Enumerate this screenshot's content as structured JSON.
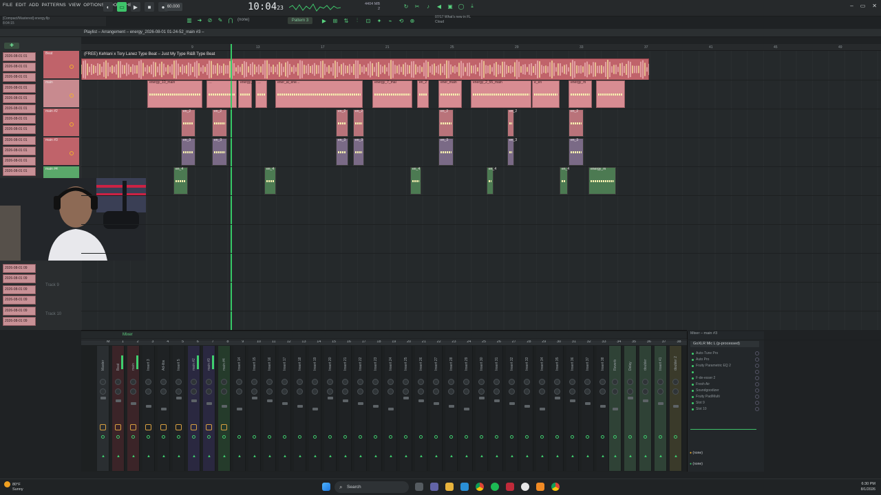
{
  "menu": [
    "FILE",
    "EDIT",
    "ADD",
    "PATTERNS",
    "VIEW",
    "OPTIONS",
    "TOOLS",
    "HELP"
  ],
  "project": {
    "file": "energy.flp",
    "pos": "8:04:15",
    "line0": "[Compact/Mastered] energy.flp"
  },
  "transport": {
    "tempo": "60.000",
    "time": "10:04",
    "time_sub": "23",
    "beat_label": "Beat"
  },
  "cpu": {
    "mem": "4404 MB",
    "voices": "2"
  },
  "pattern_label": "Pattern 3",
  "none_label": "(none)",
  "hint": {
    "line1": "07/17  What's new in FL",
    "line2": "Cloud"
  },
  "playlist": {
    "title": "Playlist – Arrangement – energy_2026-08-01 01-24-52_main #3 –",
    "top_clip_label": "(FREE) Kehlani x Tory Lanez Type Beat – Just My Type R&B Type Beat",
    "ruler": [
      "9",
      "13",
      "17",
      "21",
      "25",
      "29",
      "33",
      "37",
      "41",
      "45",
      "49",
      "53",
      "57",
      "61",
      "65"
    ],
    "track_names": [
      "2026-08-01 01",
      "2026-08-01 01",
      "2026-08-01 01",
      "2026-08-01 01",
      "2026-08-01 01",
      "2026-08-01 01",
      "2026-08-01 01",
      "2026-08-01 01",
      "2026-08-01 01",
      "2026-08-01 01",
      "2026-08-01 01",
      "2026-08-01 01"
    ],
    "lower_track_names": [
      "2026-08-01 09",
      "2026-08-01 09",
      "2026-08-01 09",
      "2026-08-01 09",
      "2026-08-01 09",
      "2026-08-01 09"
    ],
    "headers": [
      "Beat",
      "main",
      "main #2",
      "main #3",
      "main #4"
    ],
    "track9": "Track 9",
    "track10": "Track 10",
    "main_clips": [
      "energy_10_main",
      "…",
      "energy_9",
      "…",
      "ener_ai_ene…",
      "energy_7_mai",
      "en_2",
      "ener_main",
      "energy_2_55_main",
      "e_en",
      "energy_m"
    ],
    "sub_clips": [
      "en_2",
      "en_2",
      "en_3",
      "en_3",
      "en_4",
      "energy_m"
    ]
  },
  "mixer": {
    "title": "Mixer",
    "numbers": [
      "M",
      "1",
      "2",
      "3",
      "4",
      "5",
      "6",
      "7",
      "8",
      "9",
      "10",
      "11",
      "12",
      "13",
      "14",
      "15",
      "16",
      "17",
      "18",
      "19",
      "20",
      "21",
      "22",
      "23",
      "24",
      "25",
      "26",
      "27",
      "28",
      "29",
      "30",
      "31",
      "32",
      "33",
      "34",
      "35",
      "36",
      "37",
      "38",
      "39",
      "40",
      "41",
      "42",
      "43"
    ],
    "strips": [
      "Master",
      "Beat",
      "main",
      "Insert 3",
      "Ad-libs",
      "Insert 5",
      "main #2",
      "main #3",
      "main #4",
      "Insert 14",
      "Insert 15",
      "Insert 16",
      "Insert 17",
      "Insert 18",
      "Insert 19",
      "Insert 20",
      "Insert 21",
      "Insert 22",
      "Insert 23",
      "Insert 24",
      "Insert 25",
      "Insert 26",
      "Insert 27",
      "Insert 28",
      "Insert 29",
      "Insert 30",
      "Insert 31",
      "Insert 32",
      "Insert 33",
      "Insert 34",
      "Insert 35",
      "Insert 36",
      "Insert 37",
      "Insert 38",
      "Reverb",
      "Delay",
      "doubler",
      "Insert 41",
      "doubler 2",
      "Insert 43"
    ]
  },
  "inserts": {
    "title": "Mixer – main #3",
    "source": "GoXLR Mic L (p-processed)",
    "slots": [
      "Auto-Tune Pro",
      "Auto Pro",
      "Fruity Parametric EQ 2",
      "",
      "F-de-esser 2",
      "Fresh Air",
      "Soundgoodizer",
      "Fruity Pad/Multi",
      "Slot 9",
      "Slot 10"
    ],
    "out": "(none)",
    "in": "(none)"
  },
  "taskbar": {
    "temp": "80°F",
    "weather": "Sunny",
    "search": "Search",
    "time": "6:30 PM",
    "date": "8/1/2026"
  },
  "colors": {
    "accent": "#3ec46a",
    "clip": "#d88c92",
    "header": "#c0636a"
  }
}
